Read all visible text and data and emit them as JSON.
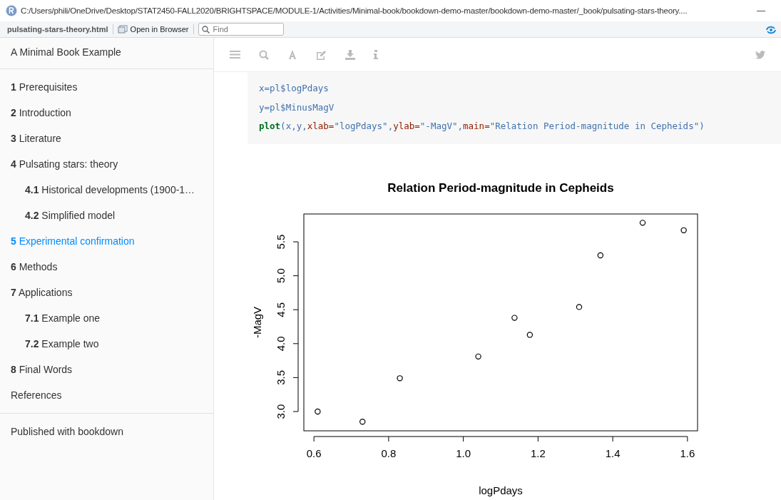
{
  "window": {
    "title": "C:/Users/phili/OneDrive/Desktop/STAT2450-FALL2020/BRIGHTSPACE/MODULE-1/Activities/Minimal-book/bookdown-demo-master/bookdown-demo-master/_book/pulsating-stars-theory...."
  },
  "toolbar": {
    "filename": "pulsating-stars-theory.html",
    "open_button": "Open in Browser",
    "find": {
      "placeholder": "Find"
    }
  },
  "sidebar": {
    "title": "A Minimal Book Example",
    "items": [
      {
        "number": "1",
        "label": "Prerequisites",
        "selected": false
      },
      {
        "number": "2",
        "label": "Introduction",
        "selected": false
      },
      {
        "number": "3",
        "label": "Literature",
        "selected": false
      },
      {
        "number": "4",
        "label": "Pulsating stars: theory",
        "selected": false,
        "children": [
          {
            "number": "4.1",
            "label": "Historical developments (1900-1…",
            "selected": false
          },
          {
            "number": "4.2",
            "label": "Simplified model",
            "selected": false
          }
        ]
      },
      {
        "number": "5",
        "label": "Experimental confirmation",
        "selected": true
      },
      {
        "number": "6",
        "label": "Methods",
        "selected": false
      },
      {
        "number": "7",
        "label": "Applications",
        "selected": false,
        "children": [
          {
            "number": "7.1",
            "label": "Example one",
            "selected": false
          },
          {
            "number": "7.2",
            "label": "Example two",
            "selected": false
          }
        ]
      },
      {
        "number": "8",
        "label": "Final Words",
        "selected": false
      },
      {
        "label": "References",
        "selected": false
      }
    ],
    "footer": "Published with bookdown"
  },
  "code": [
    [
      {
        "kind": "var",
        "text": "x=pl$logPdays"
      }
    ],
    [
      {
        "kind": "var",
        "text": "y=pl$MinusMagV"
      }
    ],
    [
      {
        "kind": "func",
        "text": "plot"
      },
      {
        "kind": "var",
        "text": "(x,y,"
      },
      {
        "kind": "arg",
        "text": "xlab="
      },
      {
        "kind": "str",
        "text": "\"logPdays\""
      },
      {
        "kind": "var",
        "text": ","
      },
      {
        "kind": "arg",
        "text": "ylab="
      },
      {
        "kind": "str",
        "text": "\"-MagV\""
      },
      {
        "kind": "var",
        "text": ","
      },
      {
        "kind": "arg",
        "text": "main="
      },
      {
        "kind": "str",
        "text": "\"Relation Period-magnitude in Cepheids\""
      },
      {
        "kind": "var",
        "text": ")"
      }
    ]
  ],
  "figure": {
    "chart_data": {
      "type": "scatter",
      "title": "Relation Period-magnitude in Cepheids",
      "xlabel": "logPdays",
      "ylabel": "-MagV",
      "x": [
        0.61,
        0.73,
        0.83,
        1.04,
        1.137,
        1.178,
        1.31,
        1.367,
        1.48,
        1.59
      ],
      "series": [
        {
          "color": "#000000",
          "values": [
            3.0,
            2.85,
            3.49,
            3.81,
            4.38,
            4.13,
            4.54,
            5.3,
            5.78,
            5.67
          ]
        }
      ],
      "xlim": [
        0.573,
        1.627
      ],
      "ylim": [
        2.716,
        5.91
      ],
      "xticks": [
        {
          "value": 0.6,
          "label": "0.6"
        },
        {
          "value": 0.8,
          "label": "0.8"
        },
        {
          "value": 1.0,
          "label": "1.0"
        },
        {
          "value": 1.2,
          "label": "1.2"
        },
        {
          "value": 1.4,
          "label": "1.4"
        },
        {
          "value": 1.6,
          "label": "1.6"
        }
      ],
      "yticks": [
        {
          "value": 3.0,
          "label": "3.0"
        },
        {
          "value": 3.5,
          "label": "3.5"
        },
        {
          "value": 4.0,
          "label": "4.0"
        },
        {
          "value": 4.5,
          "label": "4.5"
        },
        {
          "value": 5.0,
          "label": "5.0"
        },
        {
          "value": 5.5,
          "label": "5.5"
        }
      ]
    }
  }
}
